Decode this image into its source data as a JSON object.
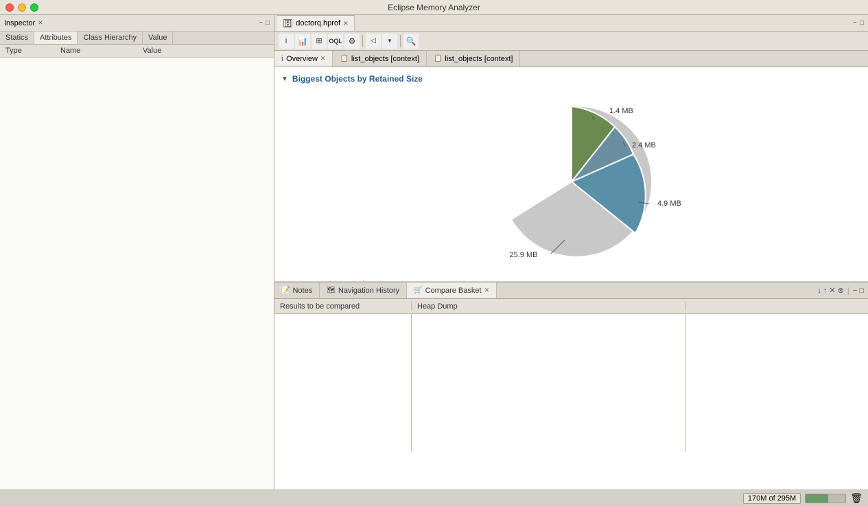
{
  "window": {
    "title": "Eclipse Memory Analyzer"
  },
  "inspector": {
    "title": "Inspector",
    "close_icon": "✕",
    "minimize_icon": "−",
    "tabs": [
      {
        "label": "Statics",
        "active": false
      },
      {
        "label": "Attributes",
        "active": true
      },
      {
        "label": "Class Hierarchy",
        "active": false
      },
      {
        "label": "Value",
        "active": false
      }
    ],
    "columns": [
      {
        "label": "Type"
      },
      {
        "label": "Name"
      },
      {
        "label": "Value"
      }
    ]
  },
  "file_tab": {
    "icon": "🗄",
    "label": "doctorq.hprof",
    "close": "✕"
  },
  "toolbar": {
    "buttons": [
      {
        "name": "info-btn",
        "icon": "ℹ",
        "tooltip": "Info"
      },
      {
        "name": "chart-btn",
        "icon": "📊",
        "tooltip": "Chart"
      },
      {
        "name": "table-btn",
        "icon": "⊞",
        "tooltip": "Table"
      },
      {
        "name": "oql-btn",
        "icon": "OQL",
        "tooltip": "OQL"
      },
      {
        "name": "settings-btn",
        "icon": "⚙",
        "tooltip": "Settings"
      },
      {
        "name": "nav-btn",
        "icon": "◁▷",
        "tooltip": "Navigation"
      },
      {
        "name": "search-btn",
        "icon": "🔍",
        "tooltip": "Search"
      }
    ]
  },
  "content_tabs": [
    {
      "label": "Overview",
      "icon": "ℹ",
      "close": "✕",
      "active": true
    },
    {
      "label": "list_objects [context]",
      "icon": "📋",
      "close": null,
      "active": false
    },
    {
      "label": "list_objects [context]",
      "icon": "📋",
      "close": null,
      "active": false
    }
  ],
  "chart": {
    "title": "Biggest Objects by Retained Size",
    "slices": [
      {
        "label": "25.9 MB",
        "value": 25.9,
        "color": "#c8c8c8",
        "angle_start": 90,
        "angle_end": 360
      },
      {
        "label": "4.9 MB",
        "value": 4.9,
        "color": "#5a8fa8",
        "angle_start": 0,
        "angle_end": 70
      },
      {
        "label": "2.4 MB",
        "value": 2.4,
        "color": "#6b8fa0",
        "angle_start": 70,
        "angle_end": 100
      },
      {
        "label": "1.4 MB",
        "value": 1.4,
        "color": "#6a8a50",
        "angle_start": 100,
        "angle_end": 120
      }
    ]
  },
  "bottom_panel": {
    "tabs": [
      {
        "label": "Notes",
        "icon": "📝",
        "active": false
      },
      {
        "label": "Navigation History",
        "icon": "🗺",
        "active": false
      },
      {
        "label": "Compare Basket",
        "icon": "🛒",
        "active": true,
        "close": "✕"
      }
    ],
    "actions": {
      "down_icon": "↓",
      "up_icon": "↑",
      "close_icon": "✕",
      "close_all_icon": "⊗",
      "sep_icon": "|",
      "minimize_icon": "−",
      "maximize_icon": "□"
    },
    "compare_columns": [
      {
        "label": "Results to be compared"
      },
      {
        "label": "Heap Dump"
      },
      {
        "label": ""
      }
    ]
  },
  "status_bar": {
    "memory_used": "170M",
    "memory_total": "295M",
    "memory_label": "170M of 295M",
    "memory_percent": 57
  }
}
